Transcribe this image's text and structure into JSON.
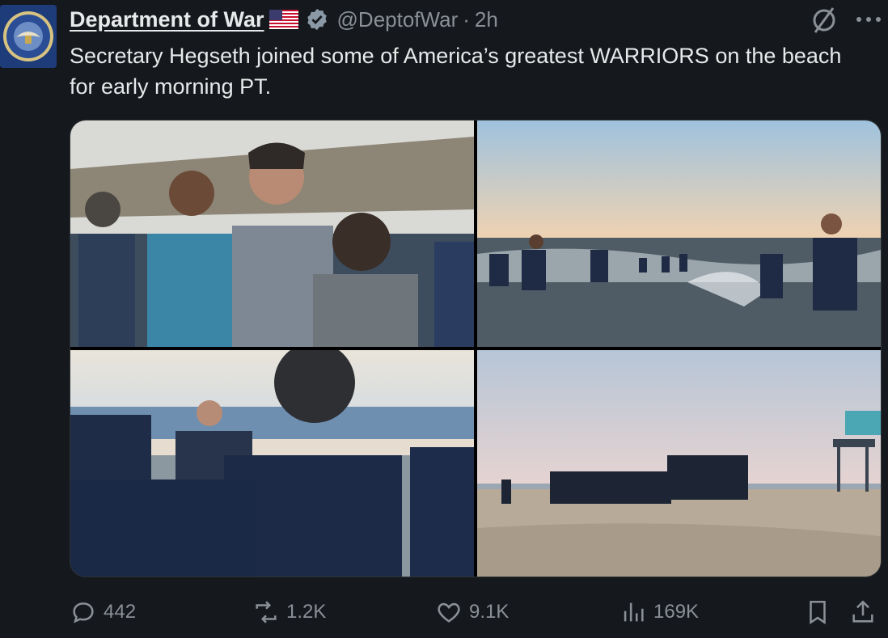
{
  "author": {
    "display_name": "Department of War",
    "flag": "🇺🇸",
    "verified_icon": "verified-badge-icon",
    "handle": "@DeptofWar",
    "separator": "·",
    "time": "2h",
    "avatar_icon": "department-seal-icon"
  },
  "tweet": {
    "text": "Secretary Hegseth joined some of America’s greatest WARRIORS on the beach for early morning PT."
  },
  "toolbar": {
    "grok_icon": "grok-icon",
    "more_icon": "more-icon"
  },
  "media": {
    "photos": [
      {
        "icon": "photo-log-carry"
      },
      {
        "icon": "photo-surf-run"
      },
      {
        "icon": "photo-beach-group"
      },
      {
        "icon": "photo-beach-run"
      }
    ]
  },
  "actions": {
    "replies": "442",
    "reposts": "1.2K",
    "likes": "9.1K",
    "views": "169K"
  },
  "colors": {
    "background": "#15181c",
    "text": "#e7e9ea",
    "muted": "#8b9096",
    "verified": "#8b98a5"
  }
}
